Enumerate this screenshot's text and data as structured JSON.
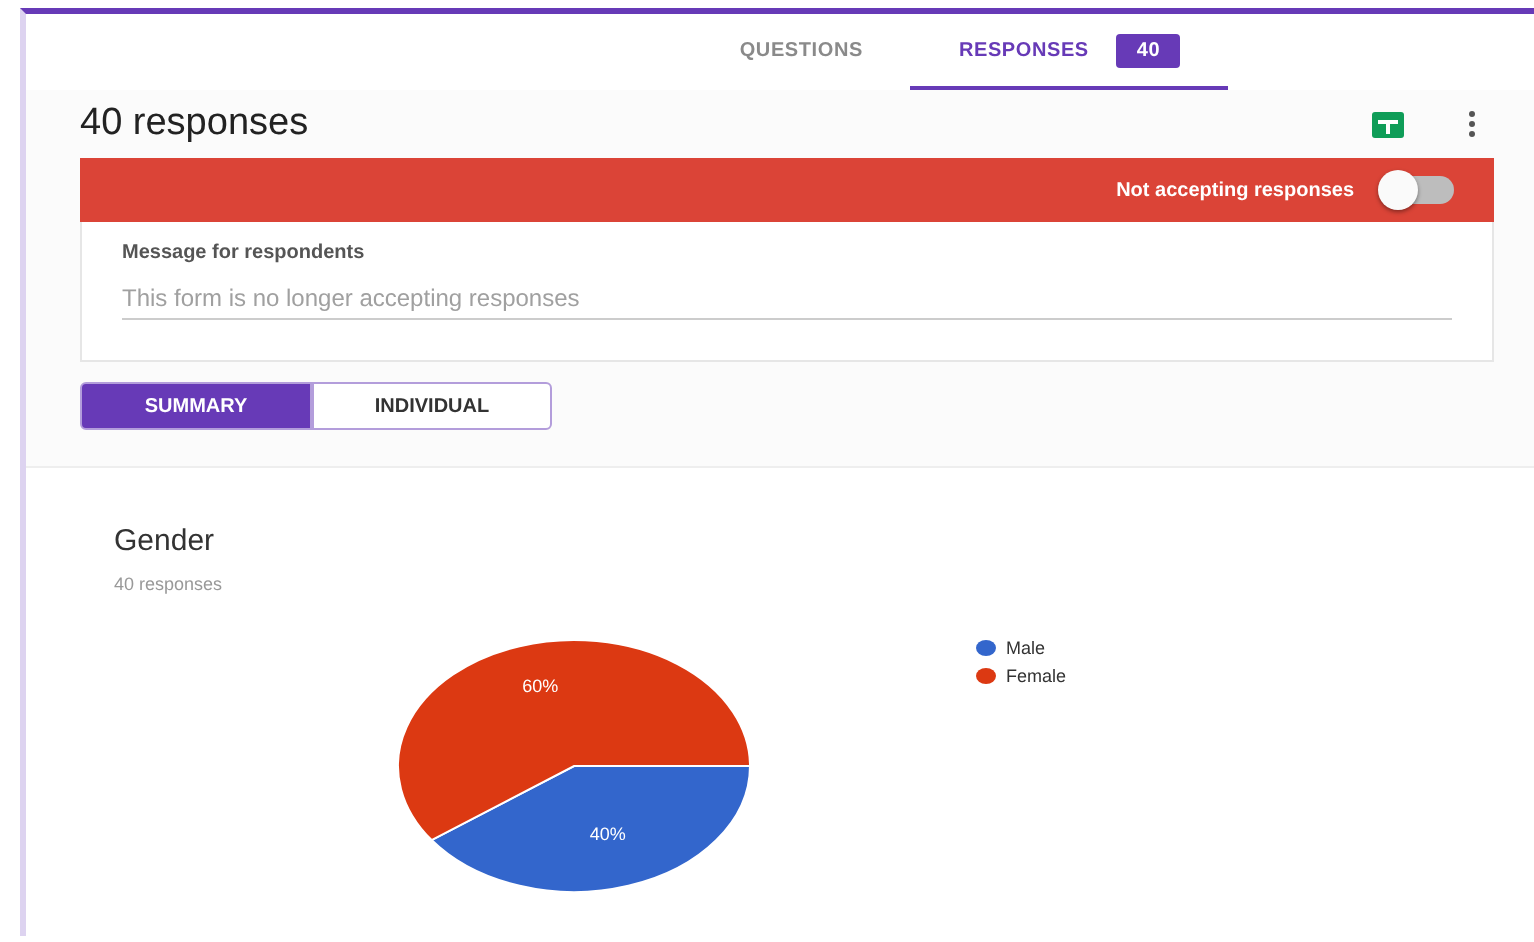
{
  "tabs": [
    {
      "label": "QUESTIONS",
      "selected": false
    },
    {
      "label": "RESPONSES",
      "selected": true,
      "badge": "40"
    }
  ],
  "title": "40 responses",
  "banner": {
    "label": "Not accepting responses",
    "on": false
  },
  "message": {
    "label": "Message for respondents",
    "placeholder": "This form is no longer accepting responses"
  },
  "views": [
    {
      "label": "SUMMARY",
      "selected": true
    },
    {
      "label": "INDIVIDUAL",
      "selected": false
    }
  ],
  "question": {
    "title": "Gender",
    "subtitle": "40 responses",
    "legend": [
      {
        "color": "#3366cc"
      },
      {
        "color": "#dc3912"
      }
    ],
    "chart_data": {
      "type": "pie",
      "categories": [
        "Male",
        "Female"
      ],
      "values": [
        40,
        60
      ],
      "value_labels": [
        "40%",
        "60%"
      ]
    }
  }
}
